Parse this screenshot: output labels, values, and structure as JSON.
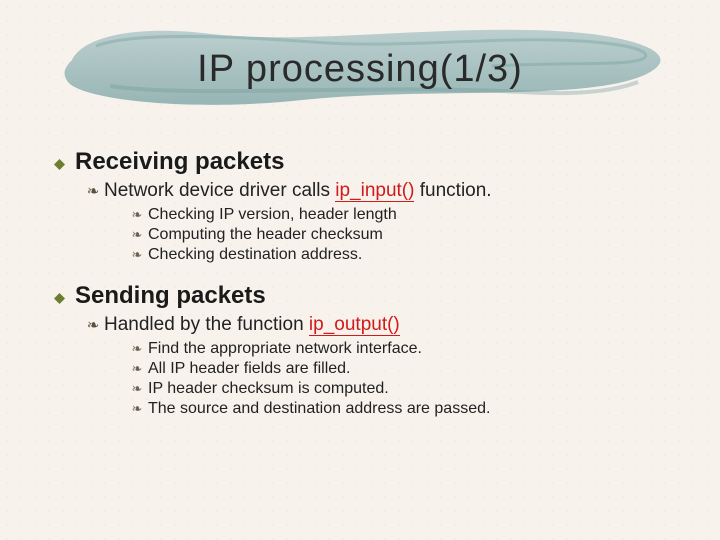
{
  "title": "IP processing(1/3)",
  "bullets": {
    "l2": "❧",
    "l3": "❧"
  },
  "colors": {
    "brush": "#a9c3c3",
    "brush_dark": "#8cb0b0",
    "accent": "#d11a1a",
    "olive": "#6a7f30"
  },
  "sections": [
    {
      "heading": "Receiving packets",
      "line_prefix": "Network device driver calls ",
      "fn": "ip_input()",
      "line_suffix": " function.",
      "items": [
        "Checking IP version, header length",
        "Computing the header checksum",
        "Checking destination address."
      ]
    },
    {
      "heading": "Sending packets",
      "line_prefix": "Handled by the function ",
      "fn": "ip_output()",
      "line_suffix": "",
      "items": [
        "Find the appropriate network interface.",
        "All IP header fields are filled.",
        "IP header checksum is computed.",
        "The source and destination address are passed."
      ]
    }
  ]
}
